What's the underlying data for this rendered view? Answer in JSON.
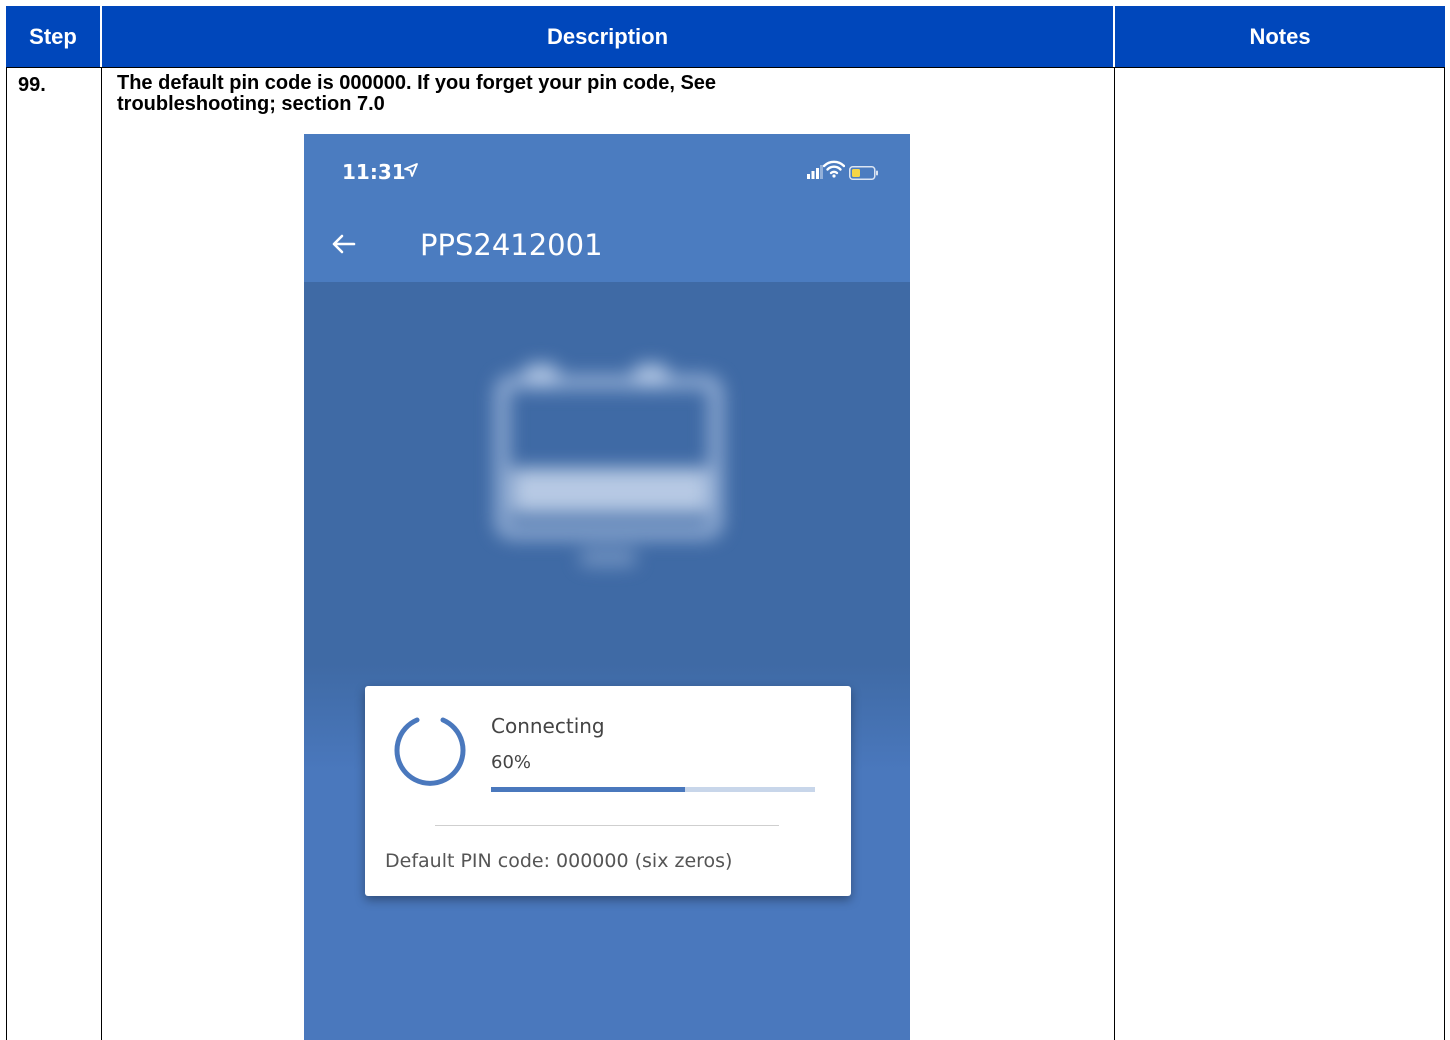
{
  "table": {
    "headers": [
      "Step",
      "Description",
      "Notes"
    ],
    "header_color": "#0047bb",
    "row": {
      "step": "99.",
      "description_line1": "The default pin code is 000000. If you forget your pin code, See",
      "description_line2": "troubleshooting; section 7.0",
      "notes": ""
    }
  },
  "phone": {
    "status_bar": {
      "time": "11:31",
      "icons": [
        "location-arrow-icon",
        "signal-bars-icon",
        "wifi-icon",
        "battery-icon"
      ]
    },
    "app_bar": {
      "back_icon": "arrow-left-icon",
      "title": "PPS2412001"
    },
    "dialog": {
      "status": "Connecting",
      "percent_text": "60%",
      "progress": 0.6,
      "note": "Default PIN code: 000000 (six zeros)"
    },
    "colors": {
      "app_blue": "#4b7cc0",
      "hero_blue": "#3f6aa5"
    }
  }
}
